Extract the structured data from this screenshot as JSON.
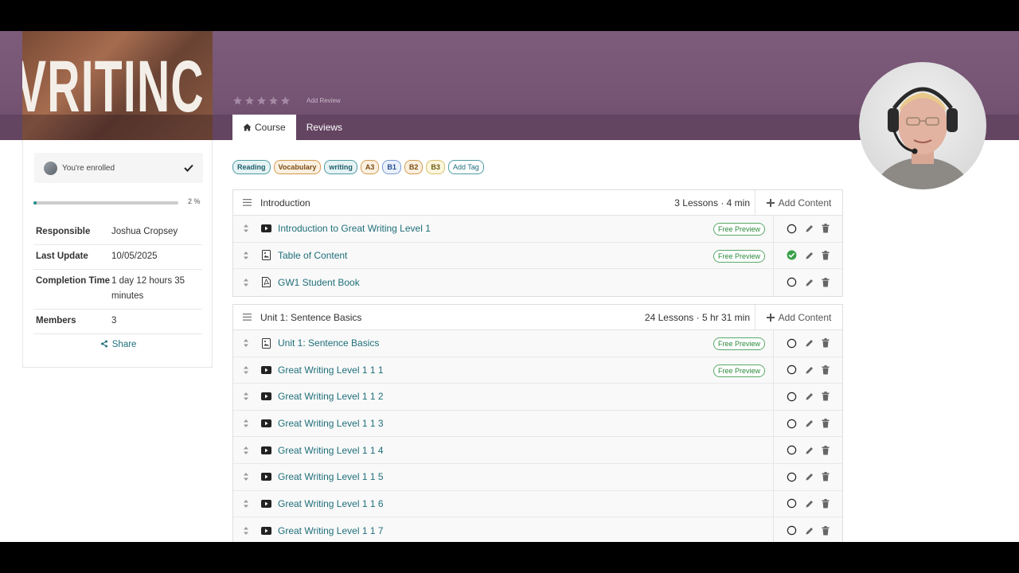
{
  "cover": {
    "text": "VRITINC"
  },
  "banner": {
    "add_review": "Add Review",
    "rating": 0
  },
  "tabs": [
    {
      "label": "Course",
      "icon": "home-icon",
      "active": true
    },
    {
      "label": "Reviews",
      "active": false
    }
  ],
  "sidebar": {
    "enrolled_label": "You're enrolled",
    "progress": 2,
    "progress_text": "2 %",
    "info": [
      {
        "key": "Responsible",
        "value": "Joshua Cropsey"
      },
      {
        "key": "Last Update",
        "value": "10/05/2025"
      },
      {
        "key": "Completion Time",
        "value": "1 day 12 hours 35 minutes"
      },
      {
        "key": "Members",
        "value": "3"
      }
    ],
    "share_label": "Share"
  },
  "tags": [
    {
      "label": "Reading",
      "style": "teal"
    },
    {
      "label": "Vocabulary",
      "style": "orange"
    },
    {
      "label": "writing",
      "style": "teal"
    },
    {
      "label": "A3",
      "style": "orange"
    },
    {
      "label": "B1",
      "style": "blue"
    },
    {
      "label": "B2",
      "style": "orange"
    },
    {
      "label": "B3",
      "style": "yellow"
    },
    {
      "label": "Add Tag",
      "style": "add"
    }
  ],
  "sections": [
    {
      "title": "Introduction",
      "meta": "3 Lessons · 4 min",
      "add_label": "Add Content",
      "lessons": [
        {
          "title": "Introduction to Great Writing Level 1",
          "type": "video",
          "free": "Free Preview",
          "done": false
        },
        {
          "title": "Table of Content",
          "type": "document",
          "free": "Free Preview",
          "done": true
        },
        {
          "title": "GW1 Student Book",
          "type": "pdf",
          "free": "",
          "done": false
        }
      ]
    },
    {
      "title": "Unit 1: Sentence Basics",
      "meta": "24 Lessons · 5 hr 31 min",
      "add_label": "Add Content",
      "lessons": [
        {
          "title": "Unit 1: Sentence Basics",
          "type": "document",
          "free": "Free Preview",
          "done": false
        },
        {
          "title": "Great Writing Level 1 1 1",
          "type": "video",
          "free": "Free Preview",
          "done": false
        },
        {
          "title": "Great Writing Level 1 1 2",
          "type": "video",
          "free": "",
          "done": false
        },
        {
          "title": "Great Writing Level 1 1 3",
          "type": "video",
          "free": "",
          "done": false
        },
        {
          "title": "Great Writing Level 1 1 4",
          "type": "video",
          "free": "",
          "done": false
        },
        {
          "title": "Great Writing Level 1 1 5",
          "type": "video",
          "free": "",
          "done": false
        },
        {
          "title": "Great Writing Level 1 1 6",
          "type": "video",
          "free": "",
          "done": false
        },
        {
          "title": "Great Writing Level 1 1 7",
          "type": "video",
          "free": "",
          "done": false
        }
      ]
    }
  ],
  "colors": {
    "banner": "#7d5b7b",
    "link": "#1f6f7a",
    "done": "#3aa14a"
  }
}
